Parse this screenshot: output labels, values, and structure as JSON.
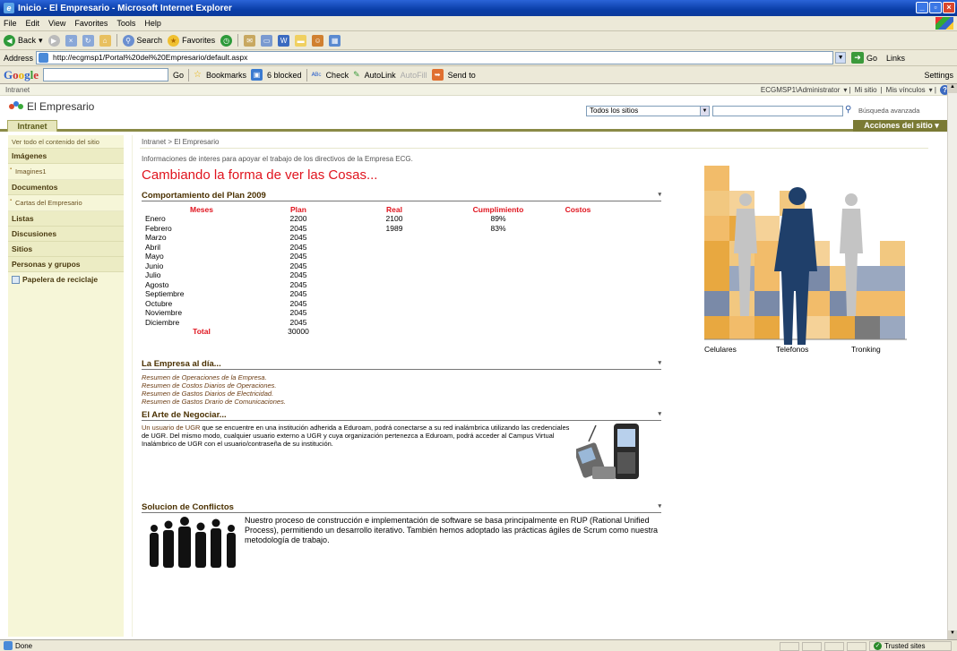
{
  "window": {
    "title": "Inicio - El Empresario - Microsoft Internet Explorer"
  },
  "menu": [
    "File",
    "Edit",
    "View",
    "Favorites",
    "Tools",
    "Help"
  ],
  "toolbar": {
    "back": "Back",
    "search": "Search",
    "favorites": "Favorites"
  },
  "address": {
    "label": "Address",
    "url": "http://ecgmsp1/Portal%20del%20Empresario/default.aspx",
    "go": "Go",
    "links": "Links"
  },
  "googlebar": {
    "logo": "Google",
    "go": "Go",
    "bookmarks": "Bookmarks",
    "blocked": "6 blocked",
    "check": "Check",
    "autolink": "AutoLink",
    "autofill": "AutoFill",
    "sendto": "Send to",
    "settings": "Settings"
  },
  "sp": {
    "site": "Intranet",
    "user": "ECGMSP1\\Administrator",
    "misitio": "Mi sitio",
    "misvinculos": "Mis vínculos",
    "logo_title": "El Empresario",
    "scope": "Todos los sitios",
    "advanced": "Búsqueda avanzada",
    "tab": "Intranet",
    "site_actions": "Acciones del sitio"
  },
  "nav": {
    "view_all": "Ver todo el contenido del sitio",
    "imagenes": "Imágenes",
    "imagenes1": "Imagines1",
    "documentos": "Documentos",
    "cartas": "Cartas del Empresario",
    "listas": "Listas",
    "discusiones": "Discusiones",
    "sitios": "Sitios",
    "personas": "Personas y grupos",
    "papelera": "Papelera de reciclaje"
  },
  "main": {
    "breadcrumb": "Intranet > El Empresario",
    "description": "Informaciones de interes para apoyar el trabajo de los directivos de la Empresa ECG.",
    "title": "Cambiando la forma de ver las Cosas...",
    "plan_title": "Comportamiento del Plan 2009",
    "plan_headers": [
      "Meses",
      "Plan",
      "Real",
      "Cumplimiento",
      "Costos"
    ],
    "plan_rows": [
      [
        "Enero",
        "2200",
        "2100",
        "89%",
        ""
      ],
      [
        "Febrero",
        "2045",
        "1989",
        "83%",
        ""
      ],
      [
        "Marzo",
        "2045",
        "",
        "",
        ""
      ],
      [
        "Abril",
        "2045",
        "",
        "",
        ""
      ],
      [
        "Mayo",
        "2045",
        "",
        "",
        ""
      ],
      [
        "Junio",
        "2045",
        "",
        "",
        ""
      ],
      [
        "Julio",
        "2045",
        "",
        "",
        ""
      ],
      [
        "Agosto",
        "2045",
        "",
        "",
        ""
      ],
      [
        "Septiembre",
        "2045",
        "",
        "",
        ""
      ],
      [
        "Octubre",
        "2045",
        "",
        "",
        ""
      ],
      [
        "Noviembre",
        "2045",
        "",
        "",
        ""
      ],
      [
        "Diciembre",
        "2045",
        "",
        "",
        ""
      ]
    ],
    "total_label": "Total",
    "total_value": "30000",
    "empresa_title": "La Empresa al día...",
    "empresa_links": [
      "Resumen de Operaciones de la Empresa.",
      "Resumen de Costos Diarios de Operaciones.",
      "Resumen de Gastos Diarios de Electricidad.",
      "Resumen de Gastos Drario de Comunicaciones."
    ],
    "arte_title": "El Arte de Negociar...",
    "arte_link": "Un usuario de UGR",
    "arte_text": " que se encuentre en una institución adherida a Eduroam, podrá conectarse a su red inalámbrica utilizando las credenciales de UGR. Del mismo modo, cualquier usuario externo a UGR y cuya organización pertenezca a Eduroam, podrá acceder al Campus Virtual Inalámbrico de UGR con el usuario/contraseña de su institución.",
    "sol_title": "Solucion de Conflictos",
    "sol_text": "Nuestro proceso de construcción e implementación de software se basa principalmente en RUP (Rational Unified Process), permitiendo un desarrollo iterativo. También hemos adoptado las prácticas ágiles de Scrum como nuestra metodología de trabajo.",
    "hero_labels": [
      "Celulares",
      "Telefonos",
      "Tronking"
    ]
  },
  "status": {
    "done": "Done",
    "zone": "Trusted sites"
  },
  "colors": {
    "accent_red": "#e0141e",
    "nav_bg": "#f6f6d8",
    "site_actions": "#7a7a34"
  }
}
